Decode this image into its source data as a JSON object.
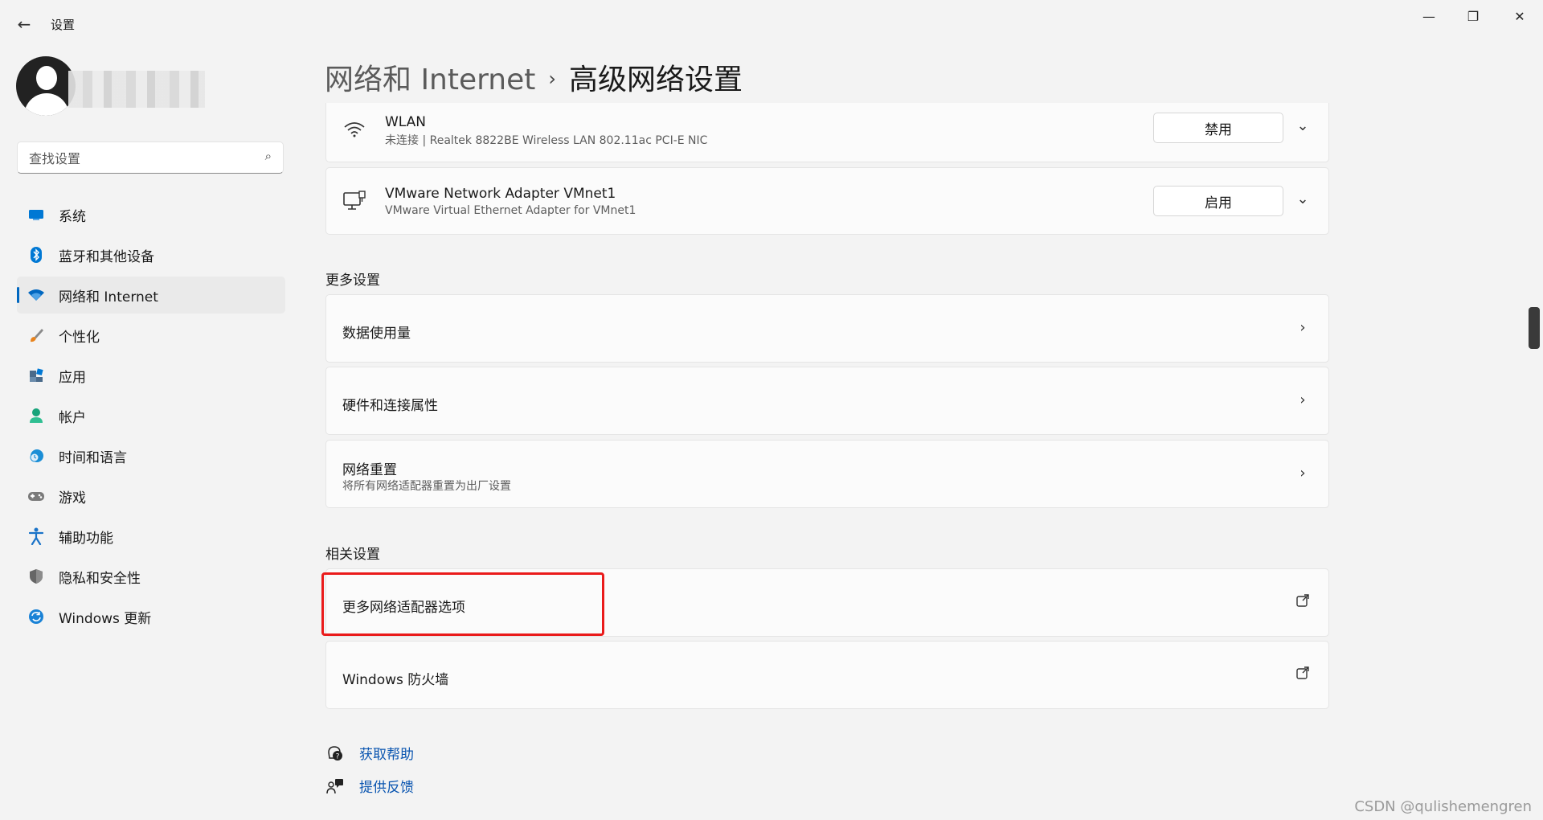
{
  "window": {
    "title": "设置",
    "controls": {
      "minimize": "—",
      "maximize": "❐",
      "close": "✕"
    }
  },
  "sidebar": {
    "search_placeholder": "查找设置",
    "items": [
      {
        "label": "系统",
        "icon": "system-icon",
        "color": "#0078d4"
      },
      {
        "label": "蓝牙和其他设备",
        "icon": "bluetooth-icon",
        "color": "#0078d4"
      },
      {
        "label": "网络和 Internet",
        "icon": "wifi-icon",
        "color": "#0067c0",
        "active": true
      },
      {
        "label": "个性化",
        "icon": "brush-icon",
        "color": "#e8831d"
      },
      {
        "label": "应用",
        "icon": "apps-icon",
        "color": "#4a6a8a"
      },
      {
        "label": "帐户",
        "icon": "account-icon",
        "color": "#17a37a"
      },
      {
        "label": "时间和语言",
        "icon": "clock-globe-icon",
        "color": "#1b8ed6"
      },
      {
        "label": "游戏",
        "icon": "gamepad-icon",
        "color": "#7a7a7a"
      },
      {
        "label": "辅助功能",
        "icon": "accessibility-icon",
        "color": "#1a73c8"
      },
      {
        "label": "隐私和安全性",
        "icon": "shield-icon",
        "color": "#666666"
      },
      {
        "label": "Windows 更新",
        "icon": "update-icon",
        "color": "#1a82d6"
      }
    ]
  },
  "breadcrumb": {
    "parent": "网络和 Internet",
    "separator": "›",
    "current": "高级网络设置"
  },
  "adapters": [
    {
      "name": "WLAN",
      "description": "未连接 | Realtek 8822BE Wireless LAN 802.11ac PCI-E NIC",
      "button": "禁用",
      "icon": "wifi-icon"
    },
    {
      "name": "VMware Network Adapter VMnet1",
      "description": "VMware Virtual Ethernet Adapter for VMnet1",
      "button": "启用",
      "icon": "ethernet-adapter-icon"
    }
  ],
  "more_settings": {
    "heading": "更多设置",
    "items": [
      {
        "title": "数据使用量"
      },
      {
        "title": "硬件和连接属性"
      },
      {
        "title": "网络重置",
        "subtitle": "将所有网络适配器重置为出厂设置"
      }
    ]
  },
  "related_settings": {
    "heading": "相关设置",
    "items": [
      {
        "title": "更多网络适配器选项",
        "highlighted": true
      },
      {
        "title": "Windows 防火墙"
      }
    ]
  },
  "help_links": [
    {
      "label": "获取帮助",
      "icon": "help-icon"
    },
    {
      "label": "提供反馈",
      "icon": "feedback-icon"
    }
  ],
  "watermark": "CSDN @qulishemengren"
}
